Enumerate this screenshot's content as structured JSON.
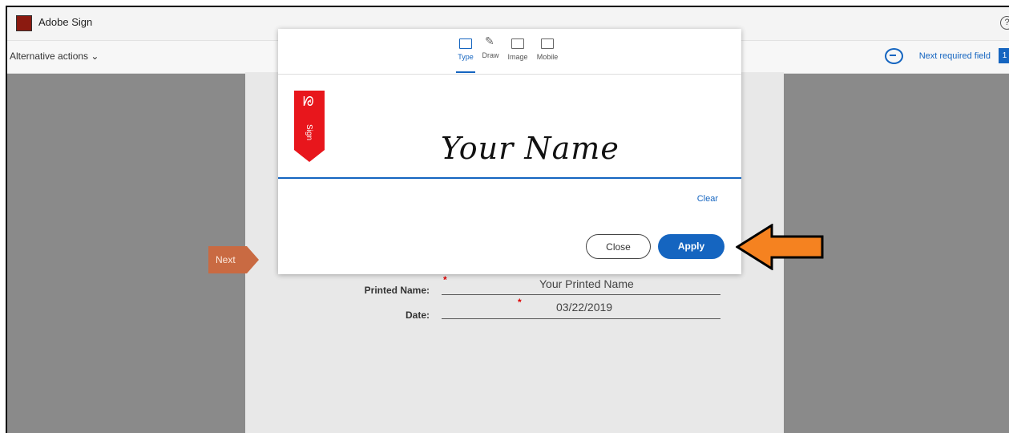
{
  "app": {
    "title": "Adobe Sign",
    "help_glyph": "?"
  },
  "subbar": {
    "alt_actions": "Alternative actions ⌄",
    "next_required": "Next required field",
    "badge_count": "1"
  },
  "next_tab": "Next",
  "form": {
    "printed_name_label": "Printed Name:",
    "printed_name_value": "Your Printed Name",
    "date_label": "Date:",
    "date_value": "03/22/2019",
    "required_mark": "*"
  },
  "modal": {
    "tabs": [
      {
        "label": "Type",
        "icon": "keyboard-icon",
        "active": true
      },
      {
        "label": "Draw",
        "icon": "pen-icon",
        "active": false
      },
      {
        "label": "Image",
        "icon": "image-icon",
        "active": false
      },
      {
        "label": "Mobile",
        "icon": "mobile-icon",
        "active": false
      }
    ],
    "ribbon_text": "Sign",
    "signature_text": "Your Name",
    "clear_label": "Clear",
    "close_label": "Close",
    "apply_label": "Apply"
  },
  "colors": {
    "accent": "#1565c0",
    "ribbon": "#e8161c",
    "next_tab": "#c96a42",
    "arrow": "#f58220"
  }
}
